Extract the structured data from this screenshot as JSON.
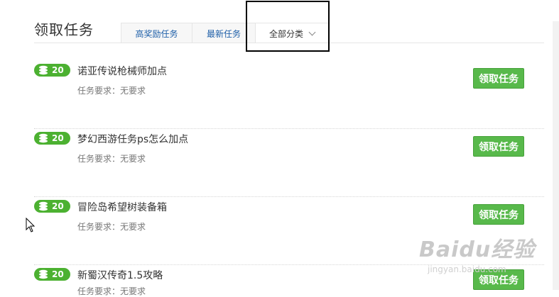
{
  "header": {
    "title": "领取任务",
    "tabs": [
      {
        "label": "高奖励任务"
      },
      {
        "label": "最新任务"
      },
      {
        "label": "全部分类"
      }
    ]
  },
  "tasks": [
    {
      "badge": "20",
      "title": "诺亚传说枪械师加点",
      "requirement": "任务要求：无要求",
      "button": "领取任务"
    },
    {
      "badge": "20",
      "title": "梦幻西游任务ps怎么加点",
      "requirement": "任务要求：无要求",
      "button": "领取任务"
    },
    {
      "badge": "20",
      "title": "冒险岛希望树装备箱",
      "requirement": "任务要求：无要求",
      "button": "领取任务"
    },
    {
      "badge": "20",
      "title": "新蜀汉传奇1.5攻略",
      "requirement": "任务要求：无要求",
      "button": "领取任务"
    }
  ],
  "watermark": {
    "logo": "Baidu经验",
    "sub": "jingyan.baidu.com"
  },
  "colors": {
    "accent_green": "#58b94b",
    "badge_green": "#4cb131",
    "tab_link": "#1e5fa8"
  }
}
